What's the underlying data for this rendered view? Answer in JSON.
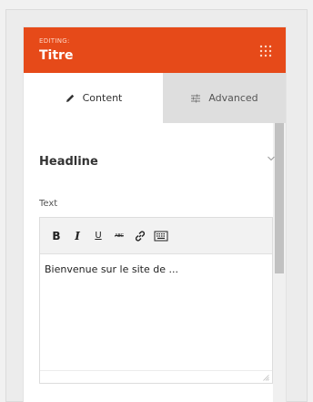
{
  "header": {
    "editing_label": "EDITING:",
    "title": "Titre",
    "menu_icon": "dots-grid-icon",
    "color": "#e64a19"
  },
  "tabs": [
    {
      "label": "Content",
      "icon": "pencil-icon",
      "active": true
    },
    {
      "label": "Advanced",
      "icon": "sliders-icon",
      "active": false
    }
  ],
  "section": {
    "title": "Headline",
    "expanded": true,
    "icon": "chevron-down-icon"
  },
  "field": {
    "label": "Text"
  },
  "editor": {
    "toolbar": {
      "bold": "B",
      "italic": "I",
      "underline": "U",
      "strike": "ABC",
      "link_icon": "link-icon",
      "keyboard_icon": "keyboard-icon"
    },
    "content": "Bienvenue sur le site de ..."
  }
}
